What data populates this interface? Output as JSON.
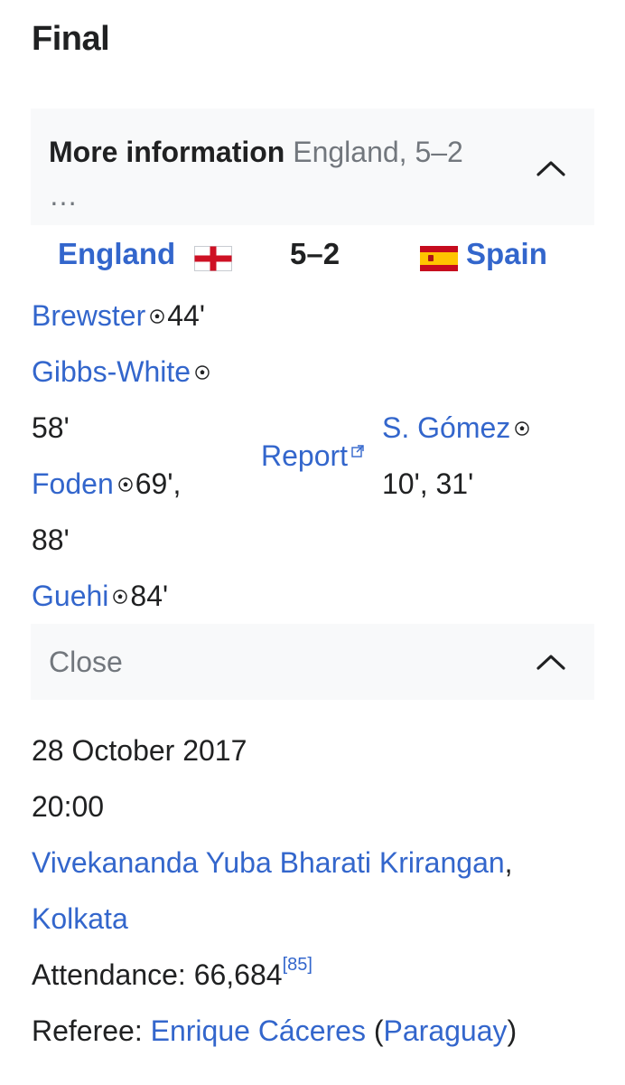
{
  "heading": "Final",
  "info_box": {
    "title": "More information",
    "summary": "England, 5–2",
    "ellipsis": "…",
    "chevron_icon": "chevron-up-icon"
  },
  "match": {
    "home_team": "England",
    "home_flag": "flag-england-icon",
    "score": "5–2",
    "away_team": "Spain",
    "away_flag": "flag-spain-icon",
    "report_label": "Report",
    "home_goals": [
      {
        "player": "Brewster",
        "minutes": "44'"
      },
      {
        "player": "Gibbs-White",
        "minutes": "58'"
      },
      {
        "player": "Foden",
        "minutes_line1": "69',",
        "minutes_line2": "88'"
      },
      {
        "player": "Guehi",
        "minutes": "84'"
      }
    ],
    "away_goals": [
      {
        "player": "S. Gómez",
        "minutes": "10', 31'"
      }
    ]
  },
  "close_box": {
    "label": "Close",
    "chevron_icon": "chevron-up-icon"
  },
  "details": {
    "date": "28 October 2017",
    "time": "20:00",
    "venue": "Vivekananda Yuba Bharati Krirangan",
    "venue_comma": ",",
    "city": "Kolkata",
    "attendance_label": "Attendance: 66,684",
    "attendance_ref": "[85]",
    "referee_label": "Referee: ",
    "referee_name": "Enrique Cáceres",
    "referee_open": " (",
    "referee_country": "Paraguay",
    "referee_close": ")"
  }
}
